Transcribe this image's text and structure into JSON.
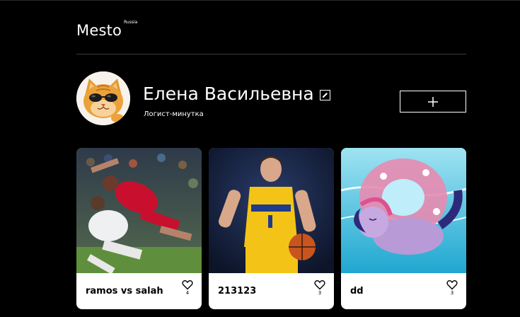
{
  "header": {
    "logo": "Mesto",
    "logo_sup": "Russia"
  },
  "profile": {
    "name": "Елена Васильевна",
    "about": "Логист-минутка",
    "add_label": "+"
  },
  "cards": [
    {
      "title": "ramos vs salah",
      "likes": "4"
    },
    {
      "title": "213123",
      "likes": "3"
    },
    {
      "title": "dd",
      "likes": "3"
    }
  ],
  "icons": {
    "edit": "pencil-icon",
    "like": "heart-icon",
    "add": "plus-icon"
  }
}
